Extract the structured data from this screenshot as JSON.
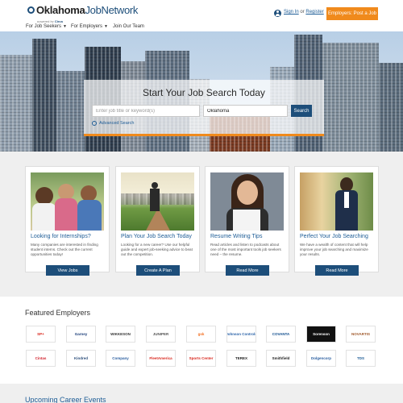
{
  "header": {
    "logo_main": "Oklahoma",
    "logo_accent": "JobNetwork",
    "logo_sub_prefix": "powered by",
    "logo_sub_brand": "Circa",
    "sign_in": "Sign In",
    "or": "or",
    "register": "Register",
    "post_job": "Employers: Post a Job"
  },
  "nav": {
    "items": [
      {
        "label": "For Job Seekers",
        "has_caret": true
      },
      {
        "label": "For Employers",
        "has_caret": true
      },
      {
        "label": "Join Our Team",
        "has_caret": false
      }
    ]
  },
  "hero": {
    "title": "Start Your Job Search Today",
    "keyword_placeholder": "Enter job title or keyword(s)",
    "location_value": "Oklahoma",
    "search_label": "Search",
    "advanced_label": "Advanced Search"
  },
  "cards": [
    {
      "title": "Looking for Internships?",
      "text": "Many companies are interested in finding student interns. Check out the current opportunities today!",
      "button": "View Jobs",
      "image": "students-photo"
    },
    {
      "title": "Plan Your Job Search Today",
      "text": "Looking for a new career? Use our helpful guide and expert job-seeking advice to beat out the competition.",
      "button": "Create A Plan",
      "image": "businessman-path-photo"
    },
    {
      "title": "Resume Writing Tips",
      "text": "Read articles and listen to podcasts about one of the most important tools job seekers need – the resume.",
      "button": "Read More",
      "image": "woman-resume-photo"
    },
    {
      "title": "Perfect Your Job Searching",
      "text": "We have a wealth of content that will help improve your job searching and maximize your results.",
      "button": "Read More",
      "image": "man-phone-photo"
    }
  ],
  "featured": {
    "title": "Featured Employers",
    "employers": [
      {
        "name": "SP+",
        "color": "#d9261c"
      },
      {
        "name": "Garney",
        "color": "#1d3f7a"
      },
      {
        "name": "WIKKESON",
        "color": "#333333"
      },
      {
        "name": "JUNIPER",
        "color": "#555555"
      },
      {
        "name": "gsk",
        "color": "#f36f21"
      },
      {
        "name": "Johnson Controls",
        "color": "#2a62a8"
      },
      {
        "name": "COVANTA",
        "color": "#0d4b8c"
      },
      {
        "name": "Sorenson",
        "color": "#ffffff"
      },
      {
        "name": "NOVARTIS",
        "color": "#a05a2c"
      },
      {
        "name": "Cintas",
        "color": "#d2222d"
      },
      {
        "name": "Kindred",
        "color": "#2b4d7a"
      },
      {
        "name": "Company",
        "color": "#2a5ea0"
      },
      {
        "name": "FleetAmerica",
        "color": "#d9261c"
      },
      {
        "name": "Sports Center",
        "color": "#d9261c"
      },
      {
        "name": "TEREX",
        "color": "#222222"
      },
      {
        "name": "Smithfield",
        "color": "#222222"
      },
      {
        "name": "Dolgencorp",
        "color": "#2a5ea0"
      },
      {
        "name": "TDS",
        "color": "#1d5c96"
      }
    ]
  },
  "upcoming": {
    "title": "Upcoming Career Events"
  },
  "colors": {
    "brand_blue": "#1d4e7a",
    "accent_orange": "#f08a1c",
    "link_blue": "#1d5c96"
  }
}
